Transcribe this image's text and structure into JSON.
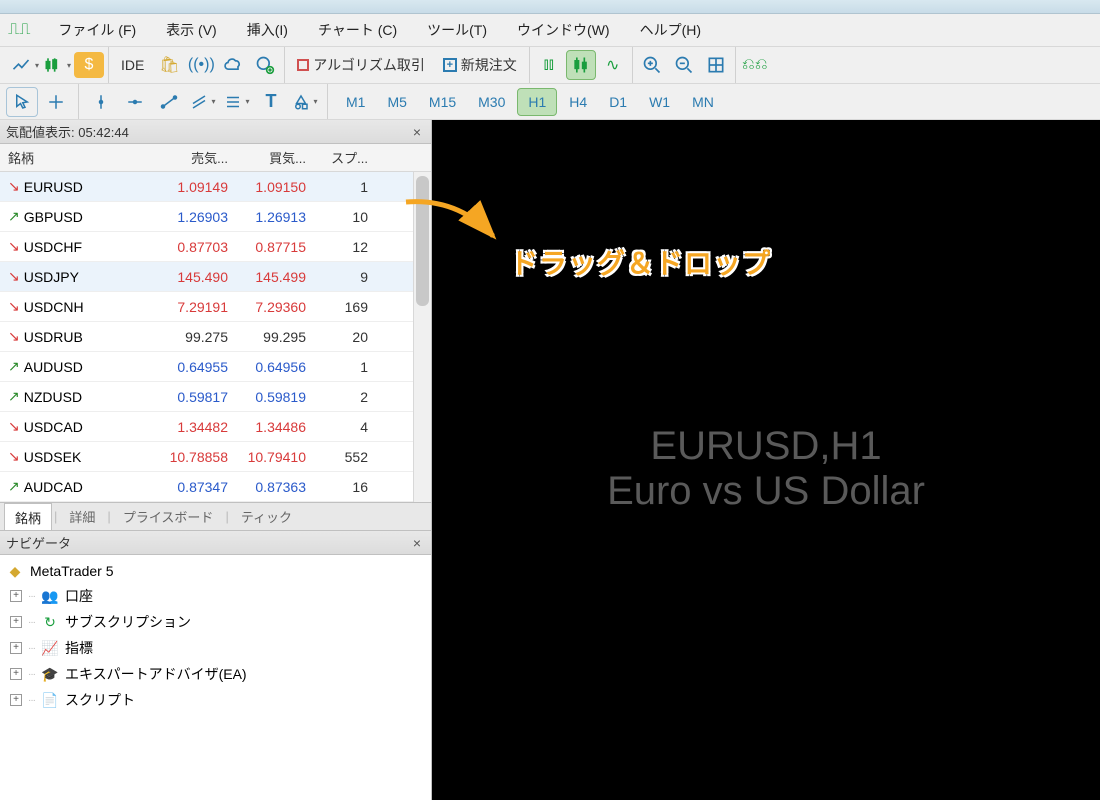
{
  "menu": {
    "file": "ファイル (F)",
    "view": "表示 (V)",
    "insert": "挿入(I)",
    "chart": "チャート (C)",
    "tools": "ツール(T)",
    "window": "ウインドウ(W)",
    "help": "ヘルプ(H)"
  },
  "toolbar": {
    "ide": "IDE",
    "algo": "アルゴリズム取引",
    "new_order": "新規注文"
  },
  "timeframes": [
    "M1",
    "M5",
    "M15",
    "M30",
    "H1",
    "H4",
    "D1",
    "W1",
    "MN"
  ],
  "timeframe_active": "H1",
  "market_watch": {
    "title": "気配値表示: 05:42:44",
    "columns": {
      "symbol": "銘柄",
      "bid": "売気...",
      "ask": "買気...",
      "spread": "スプ..."
    },
    "rows": [
      {
        "sym": "EURUSD",
        "bid": "1.09149",
        "ask": "1.09150",
        "spr": "1",
        "dir": "down",
        "sel": true
      },
      {
        "sym": "GBPUSD",
        "bid": "1.26903",
        "ask": "1.26913",
        "spr": "10",
        "dir": "up"
      },
      {
        "sym": "USDCHF",
        "bid": "0.87703",
        "ask": "0.87715",
        "spr": "12",
        "dir": "down"
      },
      {
        "sym": "USDJPY",
        "bid": "145.490",
        "ask": "145.499",
        "spr": "9",
        "dir": "down",
        "sel": true
      },
      {
        "sym": "USDCNH",
        "bid": "7.29191",
        "ask": "7.29360",
        "spr": "169",
        "dir": "down"
      },
      {
        "sym": "USDRUB",
        "bid": "99.275",
        "ask": "99.295",
        "spr": "20",
        "dir": "down",
        "flat": true
      },
      {
        "sym": "AUDUSD",
        "bid": "0.64955",
        "ask": "0.64956",
        "spr": "1",
        "dir": "up"
      },
      {
        "sym": "NZDUSD",
        "bid": "0.59817",
        "ask": "0.59819",
        "spr": "2",
        "dir": "up"
      },
      {
        "sym": "USDCAD",
        "bid": "1.34482",
        "ask": "1.34486",
        "spr": "4",
        "dir": "down"
      },
      {
        "sym": "USDSEK",
        "bid": "10.78858",
        "ask": "10.79410",
        "spr": "552",
        "dir": "down"
      },
      {
        "sym": "AUDCAD",
        "bid": "0.87347",
        "ask": "0.87363",
        "spr": "16",
        "dir": "up"
      }
    ],
    "tabs": {
      "symbols": "銘柄",
      "details": "詳細",
      "board": "プライスボード",
      "tick": "ティック"
    }
  },
  "navigator": {
    "title": "ナビゲータ",
    "root": "MetaTrader 5",
    "items": [
      {
        "label": "口座",
        "icon": "account",
        "color": "#2b7bb0"
      },
      {
        "label": "サブスクリプション",
        "icon": "refresh",
        "color": "#1a9e3e"
      },
      {
        "label": "指標",
        "icon": "indicator",
        "color": "#c94a8a"
      },
      {
        "label": "エキスパートアドバイザ(EA)",
        "icon": "grad",
        "color": "#d4a830"
      },
      {
        "label": "スクリプト",
        "icon": "script",
        "color": "#d4a830"
      }
    ]
  },
  "chart": {
    "line1": "EURUSD,H1",
    "line2": "Euro vs US Dollar"
  },
  "annotation": {
    "label": "ドラッグ＆ドロップ"
  }
}
